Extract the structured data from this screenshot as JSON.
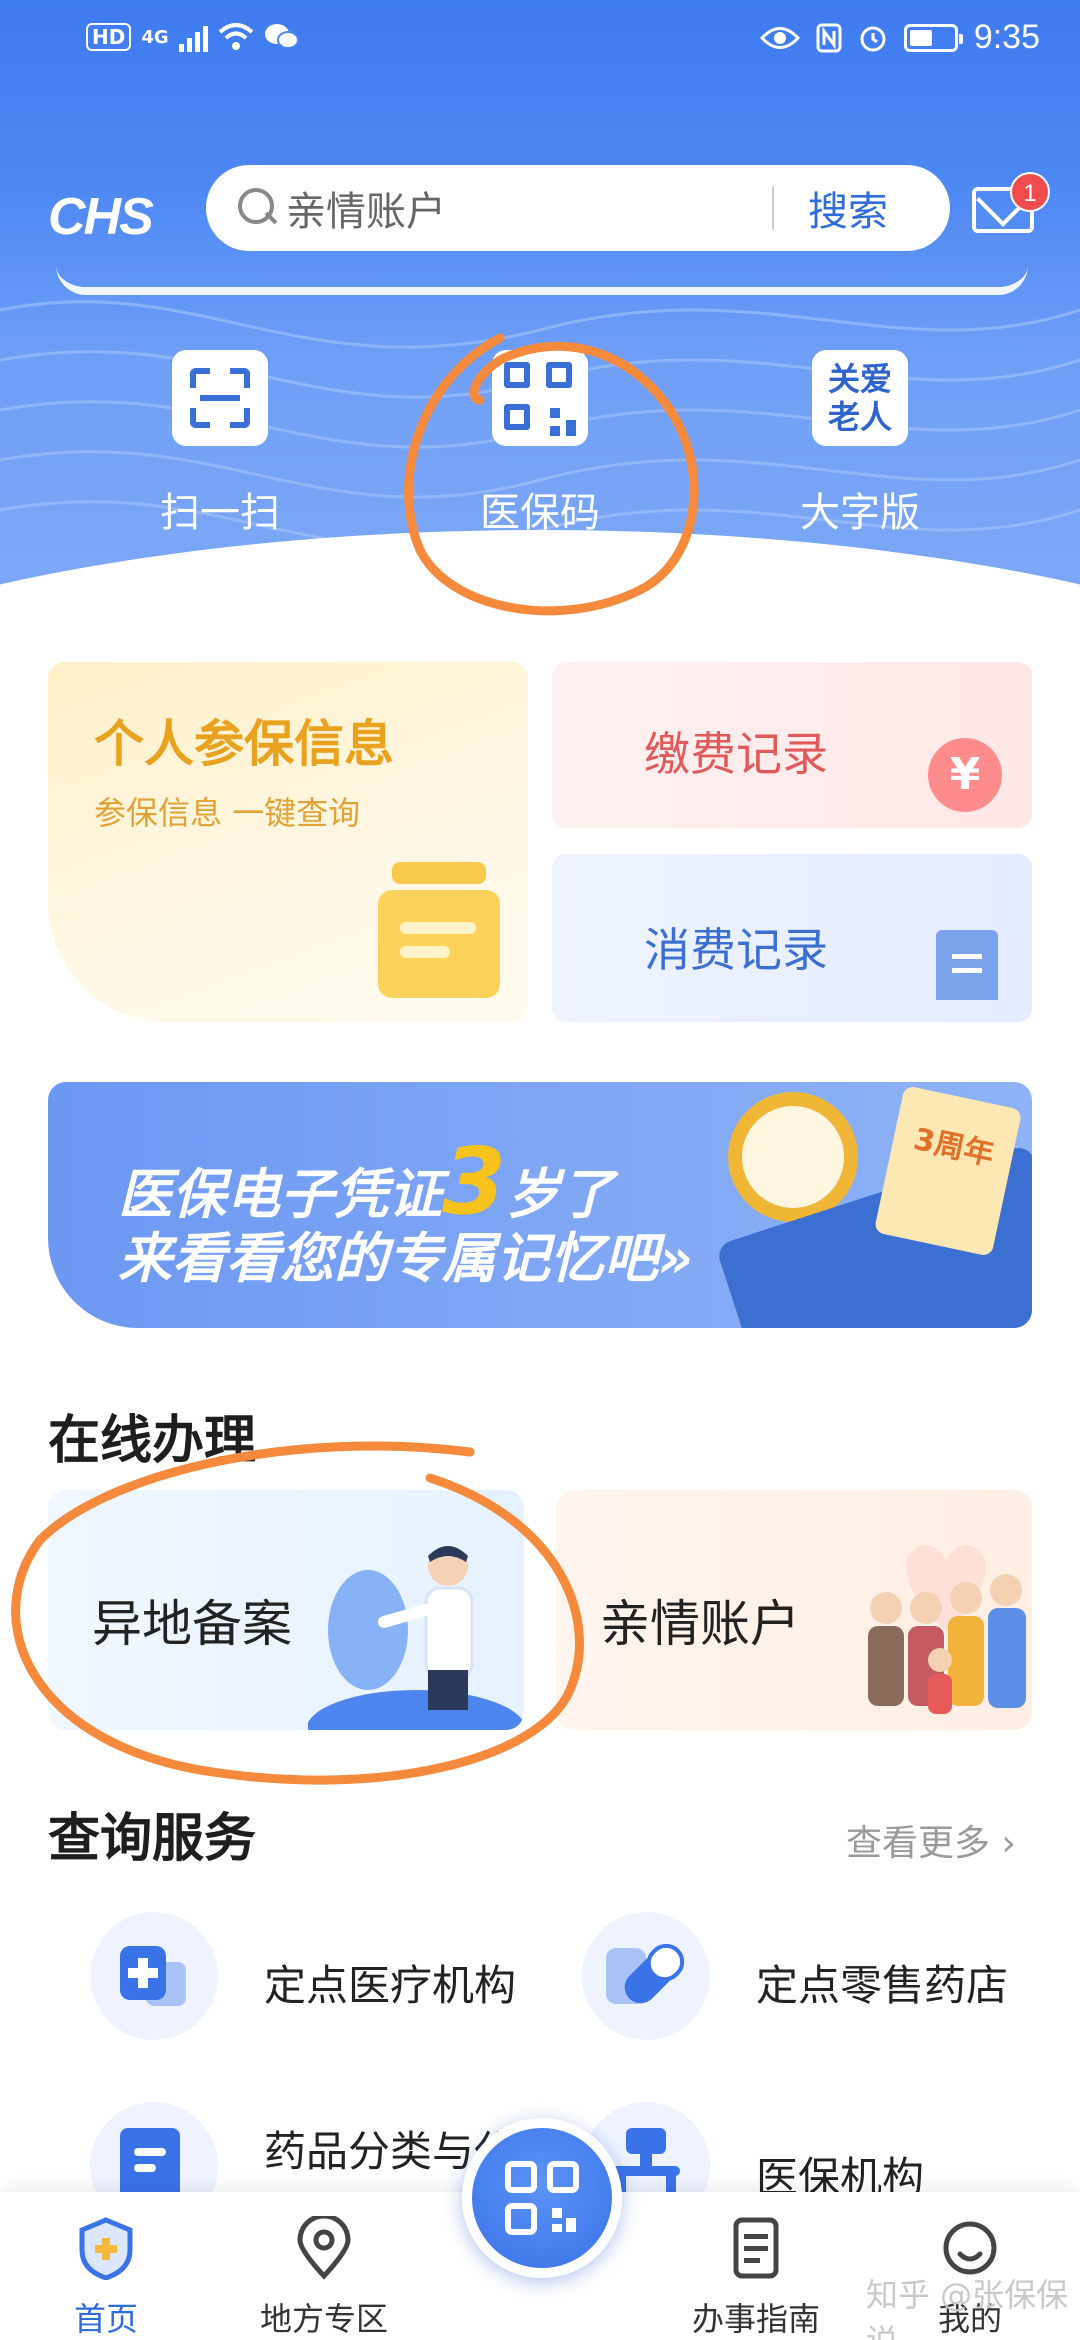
{
  "status_bar": {
    "time": "9:35",
    "hd": "HD",
    "network": "4G"
  },
  "header": {
    "logo": "CHS",
    "search": {
      "value": "亲情账户",
      "button": "搜索"
    },
    "mail_badge": "1"
  },
  "quick_actions": [
    {
      "label": "扫一扫",
      "icon": "scan-icon"
    },
    {
      "label": "医保码",
      "icon": "qr-code-icon"
    },
    {
      "label": "大字版",
      "icon": "elderly-care-icon",
      "icon_text": "关爱老人"
    }
  ],
  "cards": {
    "insurance_info": {
      "title": "个人参保信息",
      "subtitle": "参保信息 一键查询"
    },
    "payment_record": {
      "title": "缴费记录",
      "icon_symbol": "¥"
    },
    "spending_record": {
      "title": "消费记录"
    }
  },
  "banner": {
    "line1_prefix": "医保电子凭证",
    "line1_number": "3",
    "line1_suffix": "岁了",
    "line2": "来看看您的专属记忆吧»",
    "badge": "3周年"
  },
  "online": {
    "title": "在线办理",
    "items": [
      {
        "label": "异地备案"
      },
      {
        "label": "亲情账户"
      }
    ]
  },
  "query": {
    "title": "查询服务",
    "more": "查看更多 ›",
    "items": [
      {
        "label": "定点医疗机构"
      },
      {
        "label": "定点零售药店"
      },
      {
        "label": "药品分类与代码"
      },
      {
        "label": "医保机构"
      }
    ]
  },
  "bottom_nav": {
    "items": [
      {
        "label": "首页"
      },
      {
        "label": "地方专区"
      },
      {
        "label": "办事指南"
      },
      {
        "label": "我的"
      }
    ]
  },
  "watermark": "知乎 @张保保说",
  "colors": {
    "primary": "#3a72e8",
    "annotation": "#f58a3c"
  }
}
